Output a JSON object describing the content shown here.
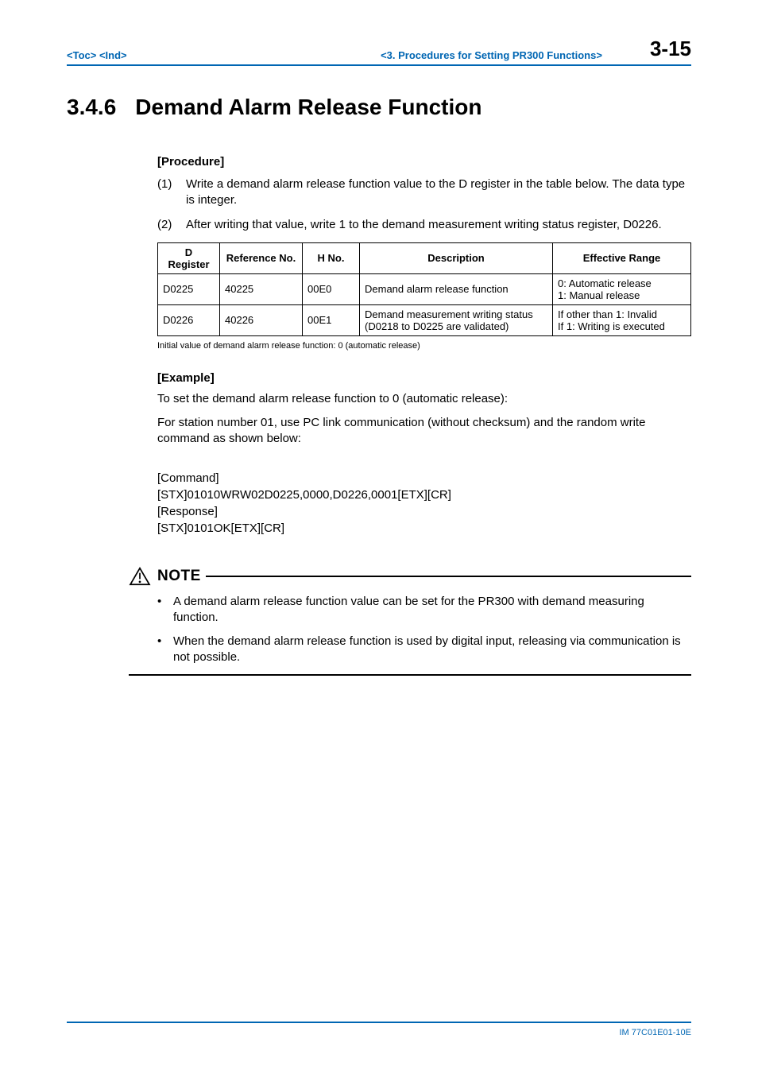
{
  "header": {
    "toc": "<Toc>",
    "ind": "<Ind>",
    "chapter": "<3.  Procedures for Setting PR300 Functions>",
    "page_number": "3-15"
  },
  "section": {
    "number": "3.4.6",
    "title": "Demand Alarm Release Function"
  },
  "procedure": {
    "heading": "[Procedure]",
    "items": [
      {
        "num": "(1)",
        "text": "Write a demand alarm release function value to the D register in the table below. The data type is integer."
      },
      {
        "num": "(2)",
        "text": "After writing that value, write 1 to the demand measurement writing status register, D0226."
      }
    ]
  },
  "table": {
    "headers": [
      "D Register",
      "Reference No.",
      "H No.",
      "Description",
      "Effective Range"
    ],
    "rows": [
      {
        "c1": "D0225",
        "c2": "40225",
        "c3": "00E0",
        "c4": "Demand alarm release function",
        "c5": "0: Automatic release\n1: Manual release"
      },
      {
        "c1": "D0226",
        "c2": "40226",
        "c3": "00E1",
        "c4": "Demand measurement writing status (D0218 to D0225 are validated)",
        "c5": "If other than 1: Invalid\nIf 1: Writing is executed"
      }
    ],
    "note": "Initial value of demand alarm release function: 0 (automatic release)"
  },
  "example": {
    "heading": "[Example]",
    "intro1": "To set the demand alarm release function to 0 (automatic release):",
    "intro2": "For station number 01, use PC link communication (without checksum) and the random write command as shown below:",
    "cmd_label": "[Command]",
    "cmd_text": "[STX]01010WRW02D0225,0000,D0226,0001[ETX][CR]",
    "resp_label": "[Response]",
    "resp_text": "[STX]0101OK[ETX][CR]"
  },
  "note_block": {
    "label": "NOTE",
    "items": [
      "A demand alarm release function value can be set for the PR300 with demand measuring function.",
      "When the demand alarm release function is used by digital input, releasing via communication is not possible."
    ]
  },
  "footer": {
    "doc_id": "IM 77C01E01-10E"
  }
}
